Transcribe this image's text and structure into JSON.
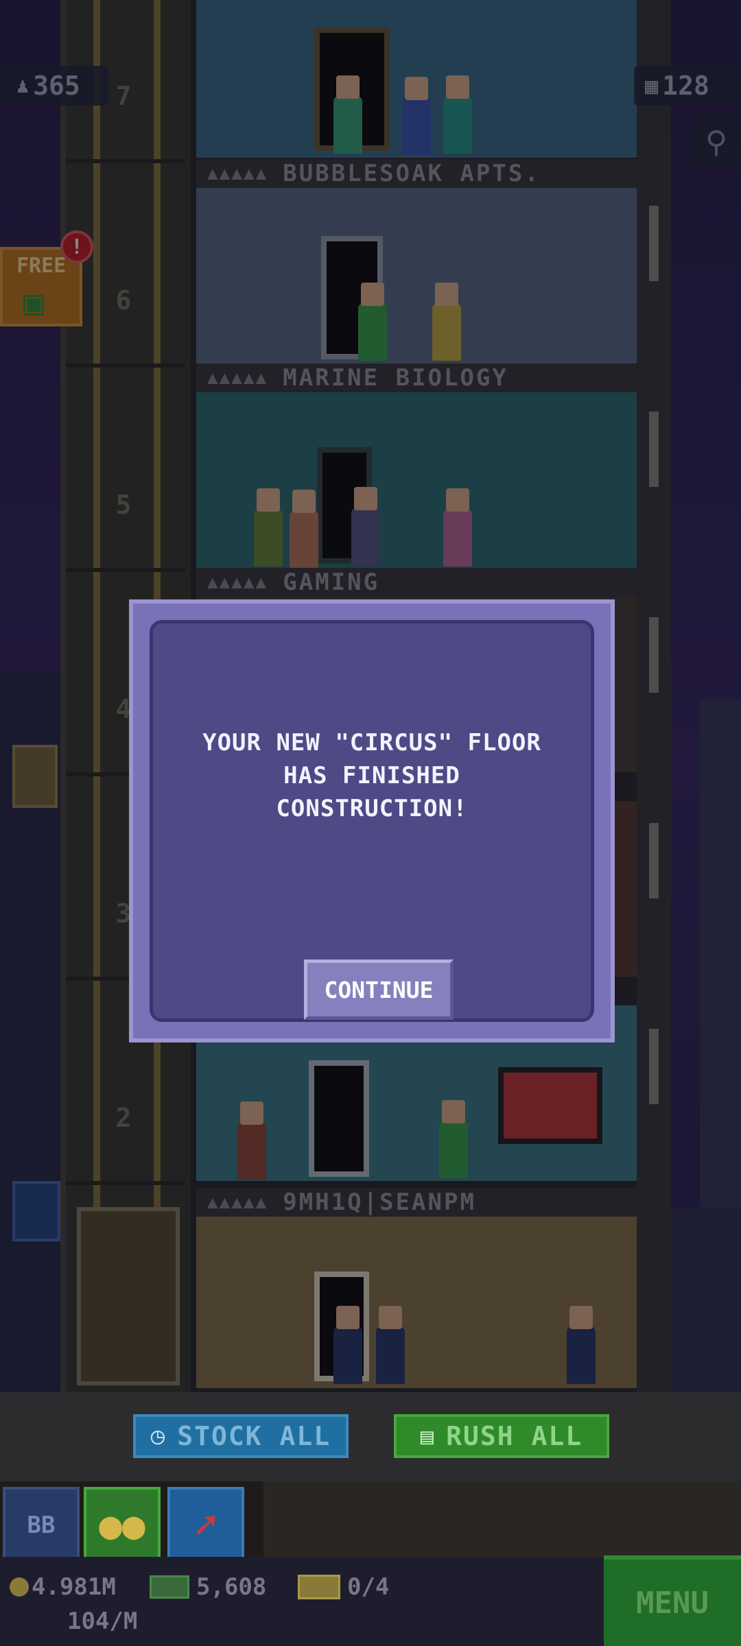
{
  "hud": {
    "population": "365",
    "bux": "128"
  },
  "free_gift": {
    "label": "FREE",
    "badge": "!"
  },
  "shaft_numbers": [
    "7",
    "6",
    "5",
    "4",
    "3",
    "2"
  ],
  "floors": [
    {
      "name": "BUBBLESOAK APTS."
    },
    {
      "name": "MARINE BIOLOGY"
    },
    {
      "name": "GAMING"
    },
    {
      "name": "9MH1Q|SEANPM"
    }
  ],
  "modal": {
    "message": "YOUR NEW \"CIRCUS\" FLOOR\nHAS FINISHED\nCONSTRUCTION!",
    "button_label": "CONTINUE"
  },
  "actions": {
    "stock_all": "STOCK ALL",
    "rush_all": "RUSH ALL"
  },
  "tabs": {
    "bb_label": "BB"
  },
  "status": {
    "coins": "4.981M",
    "coin_rate": "104/M",
    "bux": "5,608",
    "tickets": "0/4",
    "menu_label": "MENU"
  },
  "colors": {
    "stock_all": "#1f6fa3",
    "rush_all": "#2f8a2a",
    "modal_bg": "#4e4a86",
    "menu": "#1f6d26"
  }
}
